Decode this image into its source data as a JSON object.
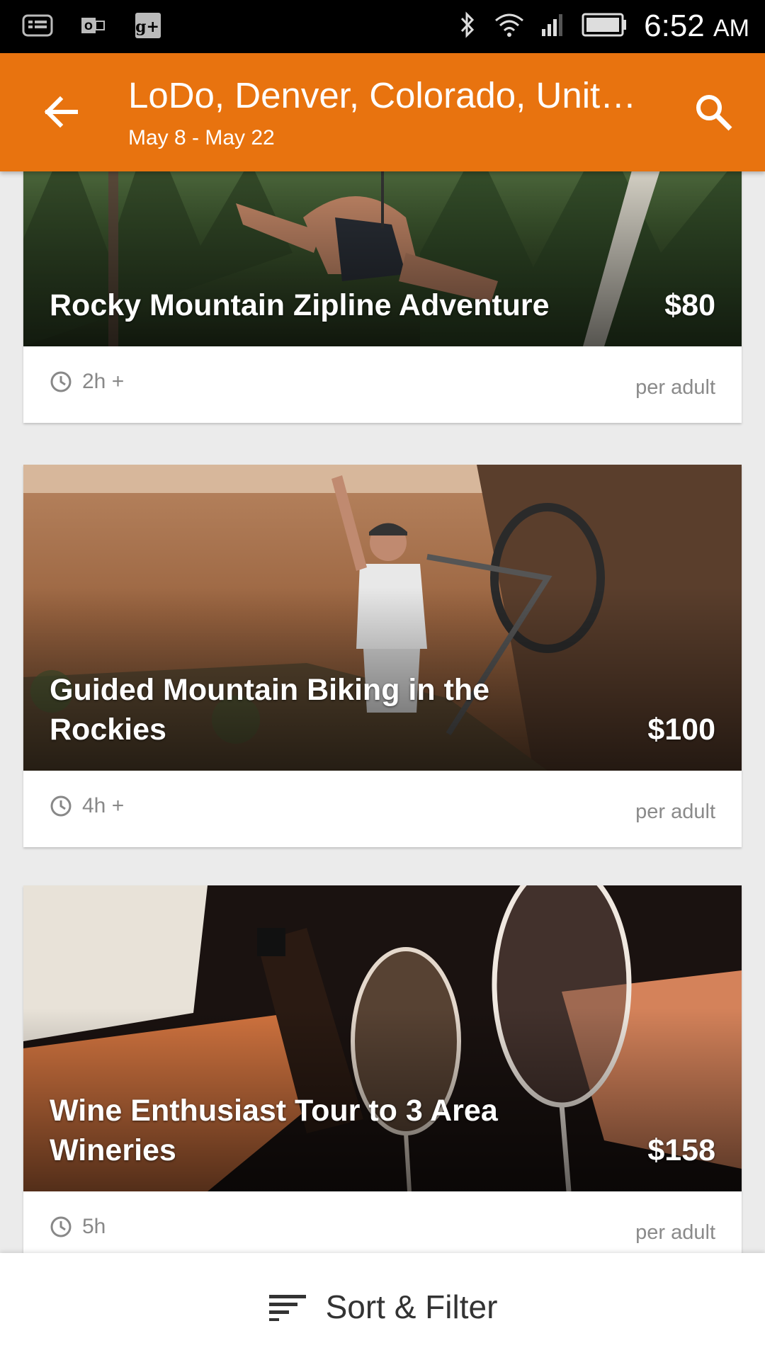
{
  "status_bar": {
    "time": "6:52",
    "ampm": "AM",
    "left_icons": [
      "news-icon",
      "outlook-icon",
      "google-plus-icon"
    ],
    "right_icons": [
      "bluetooth-icon",
      "wifi-icon",
      "signal-icon",
      "battery-icon"
    ]
  },
  "app_bar": {
    "title": "LoDo, Denver, Colorado, United States",
    "subtitle": "May 8 - May 22",
    "back_icon": "arrow-back-icon",
    "search_icon": "search-icon",
    "color": "#e8730f"
  },
  "cards": [
    {
      "title": "Rocky Mountain Zipline Adventure",
      "price": "$80",
      "duration": "2h +",
      "price_unit": "per adult"
    },
    {
      "title": "Guided Mountain Biking in the Rockies",
      "price": "$100",
      "duration": "4h +",
      "price_unit": "per adult"
    },
    {
      "title": "Wine Enthusiast Tour to 3 Area Wineries",
      "price": "$158",
      "duration": "5h",
      "price_unit": "per adult"
    }
  ],
  "bottom_bar": {
    "label": "Sort & Filter",
    "icon": "sort-icon"
  }
}
